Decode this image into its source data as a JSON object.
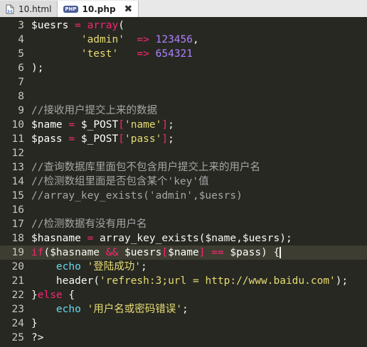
{
  "tabs": [
    {
      "label": "10.html",
      "icon": "file-icon",
      "active": false
    },
    {
      "label": "10.php",
      "icon": "php-file-icon",
      "active": true
    }
  ],
  "php_badge": "PHP",
  "close_glyph": "✖",
  "editor": {
    "lines": [
      {
        "num": "3",
        "tokens": [
          [
            "$uesrs",
            "var"
          ],
          [
            " = ",
            "op"
          ],
          [
            "array",
            "fn"
          ],
          [
            "(",
            "plain"
          ]
        ]
      },
      {
        "num": "4",
        "tokens": [
          [
            "        ",
            "plain"
          ],
          [
            "'admin'",
            "str"
          ],
          [
            "  => ",
            "op"
          ],
          [
            "123456",
            "num"
          ],
          [
            ",",
            "plain"
          ]
        ]
      },
      {
        "num": "5",
        "tokens": [
          [
            "        ",
            "plain"
          ],
          [
            "'test'",
            "str"
          ],
          [
            "   => ",
            "op"
          ],
          [
            "654321",
            "num"
          ]
        ]
      },
      {
        "num": "6",
        "tokens": [
          [
            ");",
            "plain"
          ]
        ]
      },
      {
        "num": "7",
        "tokens": []
      },
      {
        "num": "8",
        "tokens": []
      },
      {
        "num": "9",
        "tokens": [
          [
            "//接收用户提交上来的数据",
            "cmt"
          ]
        ]
      },
      {
        "num": "10",
        "tokens": [
          [
            "$name",
            "var"
          ],
          [
            " = ",
            "op"
          ],
          [
            "$_POST",
            "var"
          ],
          [
            "[",
            "op"
          ],
          [
            "'name'",
            "str"
          ],
          [
            "]",
            "op"
          ],
          [
            ";",
            "plain"
          ]
        ]
      },
      {
        "num": "11",
        "tokens": [
          [
            "$pass",
            "var"
          ],
          [
            " = ",
            "op"
          ],
          [
            "$_POST",
            "var"
          ],
          [
            "[",
            "op"
          ],
          [
            "'pass'",
            "str"
          ],
          [
            "]",
            "op"
          ],
          [
            ";",
            "plain"
          ]
        ]
      },
      {
        "num": "12",
        "tokens": []
      },
      {
        "num": "13",
        "tokens": [
          [
            "//查询数据库里面包不包含用户提交上来的用户名",
            "cmt"
          ]
        ]
      },
      {
        "num": "14",
        "tokens": [
          [
            "//检测数组里面是否包含某个'key'值",
            "cmt"
          ]
        ]
      },
      {
        "num": "15",
        "tokens": [
          [
            "//array_key_exists('admin',$uesrs)",
            "cmt"
          ]
        ]
      },
      {
        "num": "16",
        "tokens": []
      },
      {
        "num": "17",
        "tokens": [
          [
            "//检测数据有没有用户名",
            "cmt"
          ]
        ]
      },
      {
        "num": "18",
        "tokens": [
          [
            "$hasname",
            "var"
          ],
          [
            " = ",
            "op"
          ],
          [
            "array_key_exists",
            "plain"
          ],
          [
            "($name,$uesrs);",
            "plain"
          ]
        ]
      },
      {
        "num": "19",
        "tokens": [
          [
            "if",
            "fn"
          ],
          [
            "($hasname",
            "plain"
          ],
          [
            " && ",
            "op"
          ],
          [
            "$uesrs",
            "var"
          ],
          [
            "[",
            "op"
          ],
          [
            "$name",
            "var"
          ],
          [
            "]",
            "op"
          ],
          [
            " == ",
            "op"
          ],
          [
            "$pass",
            "var"
          ],
          [
            ") {",
            "plain"
          ]
        ],
        "current": true
      },
      {
        "num": "20",
        "tokens": [
          [
            "    ",
            "plain"
          ],
          [
            "echo",
            "kw"
          ],
          [
            " ",
            "plain"
          ],
          [
            "'登陆成功'",
            "str"
          ],
          [
            ";",
            "plain"
          ]
        ]
      },
      {
        "num": "21",
        "tokens": [
          [
            "    ",
            "plain"
          ],
          [
            "header",
            "plain"
          ],
          [
            "(",
            "plain"
          ],
          [
            "'refresh:3;url = http://www.baidu.com'",
            "str"
          ],
          [
            ");",
            "plain"
          ]
        ]
      },
      {
        "num": "22",
        "tokens": [
          [
            "}",
            "plain"
          ],
          [
            "else",
            "fn"
          ],
          [
            " {",
            "plain"
          ]
        ]
      },
      {
        "num": "23",
        "tokens": [
          [
            "    ",
            "plain"
          ],
          [
            "echo",
            "kw"
          ],
          [
            " ",
            "plain"
          ],
          [
            "'用户名或密码错误'",
            "str"
          ],
          [
            ";",
            "plain"
          ]
        ]
      },
      {
        "num": "24",
        "tokens": [
          [
            "}",
            "plain"
          ]
        ]
      },
      {
        "num": "25",
        "tokens": [
          [
            "?>",
            "plain"
          ]
        ]
      }
    ]
  }
}
